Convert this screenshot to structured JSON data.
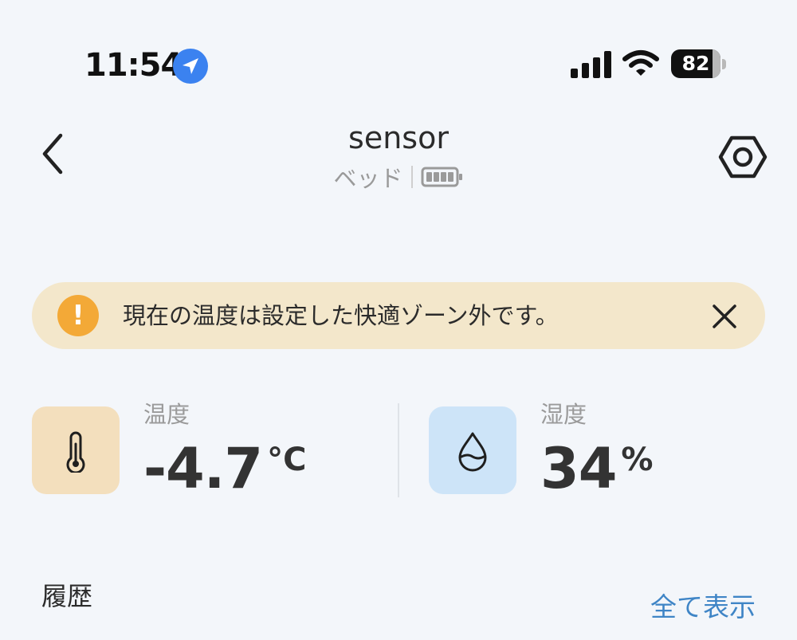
{
  "status_bar": {
    "time": "11:54",
    "battery_level": "82",
    "icons": {
      "location": "location-arrow-icon",
      "signal": "cellular-signal-icon",
      "wifi": "wifi-icon",
      "battery": "battery-icon"
    }
  },
  "header": {
    "title": "sensor",
    "location": "ベッド",
    "device_battery_icon": "device-battery-full-icon",
    "back_icon": "chevron-left-icon",
    "settings_icon": "hexagon-gear-icon"
  },
  "alert": {
    "message": "現在の温度は設定した快適ゾーン外です。",
    "icon": "exclamation-icon",
    "close_icon": "close-icon",
    "background_color": "#f3e7cb",
    "icon_color": "#f3a937"
  },
  "readings": {
    "temperature": {
      "label": "温度",
      "value": "-4.7",
      "unit": "°C",
      "icon": "thermometer-icon",
      "tile_color": "#f3dfbd"
    },
    "humidity": {
      "label": "湿度",
      "value": "34",
      "unit": "%",
      "icon": "water-drop-icon",
      "tile_color": "#cde4f8"
    }
  },
  "history": {
    "title": "履歴",
    "show_all_label": "全て表示",
    "link_color": "#3f85c6"
  },
  "colors": {
    "background": "#f3f6fa",
    "primary_text": "#2b2b2b",
    "secondary_text": "#9a9a9a"
  }
}
